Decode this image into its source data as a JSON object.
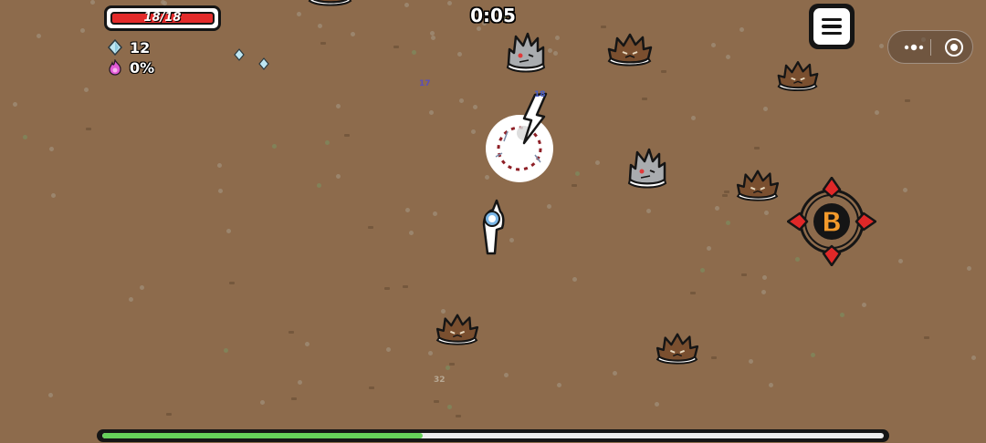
{
  "hud": {
    "hp_text": "18/18",
    "hp_current": 18,
    "hp_max": 18,
    "gems_count": "12",
    "rage_percent": "0%",
    "timer": "0:05"
  },
  "damage_numbers": [
    {
      "id": "dmg-17",
      "text": "17",
      "color": "#5a4fb8"
    },
    {
      "id": "dmg-18",
      "text": "18",
      "color": "#4a5fc8"
    },
    {
      "id": "dmg-32",
      "text": "32",
      "color": "#b7a894"
    }
  ],
  "skill_button": {
    "label": "B"
  },
  "experience_progress": 0.41,
  "icons": {
    "menu": "hamburger-menu-icon",
    "more": "more-dots-icon",
    "close": "target-circle-icon",
    "gem": "diamond-gem-icon",
    "rage": "pink-flame-icon"
  },
  "colors": {
    "ground": "#8d6b4c",
    "hp_fill": "#e32b2b",
    "xp_fill": "#66d15a",
    "skill_red": "#e02828",
    "skill_orange": "#f39a2b"
  },
  "enemies": [
    {
      "type": "brown-spiky-slime"
    },
    {
      "type": "brown-spiky-slime"
    },
    {
      "type": "brown-spiky-slime"
    },
    {
      "type": "brown-spiky-slime"
    },
    {
      "type": "brown-spiky-slime"
    },
    {
      "type": "gray-spiky-slime"
    },
    {
      "type": "gray-spiky-slime"
    }
  ]
}
